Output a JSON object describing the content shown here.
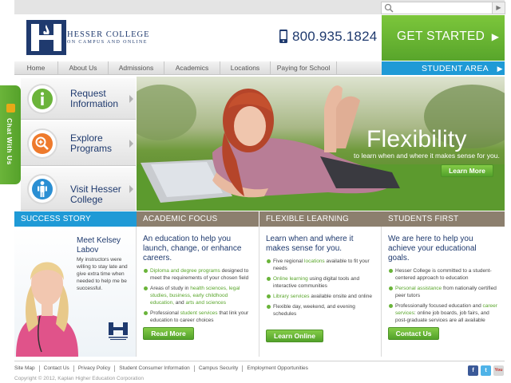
{
  "search": {
    "placeholder": "",
    "go": "▶"
  },
  "brand": {
    "name_line1": "HESSER COLLEGE",
    "name_line2": "ON CAMPUS AND ONLINE",
    "color": "#1f3a6e"
  },
  "phone": "800.935.1824",
  "cta": {
    "get_started": "GET STARTED",
    "student_area": "STUDENT AREA",
    "accent": "#6bb43a",
    "blue": "#1f9ad6"
  },
  "nav": [
    "Home",
    "About Us",
    "Admissions",
    "Academics",
    "Locations",
    "Paying for School"
  ],
  "chat": {
    "label": "Chat With Us"
  },
  "quick_links": [
    {
      "line1": "Request",
      "line2": "Information",
      "icon": "info-icon"
    },
    {
      "line1": "Explore",
      "line2": "Programs",
      "icon": "magnifier-icon"
    },
    {
      "line1": "Visit Hesser",
      "line2": "College",
      "icon": "person-icon"
    }
  ],
  "hero": {
    "title": "Flexibility",
    "subtitle": "to learn when and where it makes sense for you.",
    "button": "Learn More"
  },
  "success_story": {
    "heading": "SUCCESS STORY",
    "name_line1": "Meet Kelsey",
    "name_line2": "Labov",
    "quote": "My instructors were willing to stay late and give extra time when needed to help me be successful."
  },
  "academic_focus": {
    "heading": "ACADEMIC FOCUS",
    "title": "An education to help you launch, change, or enhance careers.",
    "items": [
      {
        "link": "Diploma and degree programs",
        "rest": " designed to meet the requirements of your chosen field"
      },
      {
        "pre": "Areas of study in ",
        "link": "health sciences, legal studies, business, early childhood education,",
        "mid": " and ",
        "link2": "arts and sciences"
      },
      {
        "pre": "Professional ",
        "link": "student services",
        "rest": " that link your education to career choices"
      }
    ],
    "button": "Read More"
  },
  "flexible_learning": {
    "heading": "FLEXIBLE LEARNING",
    "title": "Learn when and where it makes sense for you.",
    "items": [
      {
        "pre": "Five regional ",
        "link": "locations",
        "rest": " available to fit your needs"
      },
      {
        "link": "Online learning",
        "rest": " using digital tools and interactive communities"
      },
      {
        "link": "Library services",
        "rest": " available onsite and online"
      },
      {
        "text": "Flexible day, weekend, and evening schedules"
      }
    ],
    "button": "Learn Online"
  },
  "students_first": {
    "heading": "STUDENTS FIRST",
    "title": "We are here to help you achieve your educational goals.",
    "items": [
      {
        "text": "Hesser College is committed to a student-centered approach to education"
      },
      {
        "link": "Personal assistance",
        "rest": " from nationally certified peer tutors"
      },
      {
        "pre": "Professionally focused education and ",
        "link": "career services",
        "rest": ": online job boards, job fairs, and post-graduate services are all available"
      }
    ],
    "button": "Contact Us"
  },
  "footer": {
    "links": [
      "Site Map",
      "Contact Us",
      "Privacy Policy",
      "Student Consumer Information",
      "Campus Security",
      "Employment Opportunities"
    ],
    "copyright": "Copyright © 2012, Kaplan Higher Education Corporation",
    "social": [
      "facebook-icon",
      "twitter-icon",
      "youtube-icon"
    ],
    "youtube_label": "You"
  }
}
